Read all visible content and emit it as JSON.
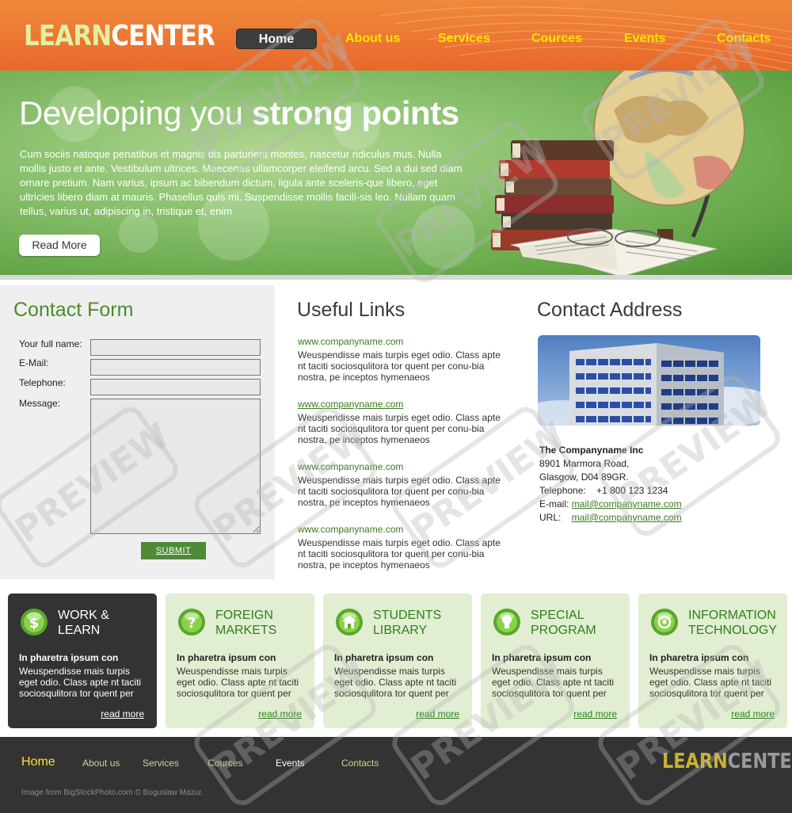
{
  "logo": {
    "part1": "LEARN",
    "part2": "CENTER"
  },
  "nav": {
    "items": [
      {
        "label": "Home",
        "active": true
      },
      {
        "label": "About us"
      },
      {
        "label": "Services"
      },
      {
        "label": "Cources"
      },
      {
        "label": "Events"
      },
      {
        "label": "Contacts"
      }
    ]
  },
  "hero": {
    "title_light": "Developing you ",
    "title_bold": "strong points",
    "text": "Cum sociis natoque penatibus et magnis dis parturient montes, nascetur ridiculus mus. Nulla mollis justo et ante. Vestibulum ultrices. Maecenas ullamcorper eleifend arcu. Sed a dui sed diam ornare pretium. Nam varius, ipsum ac bibendum dictum, ligula ante sceleris-que libero, eget ultricies libero diam at mauris. Phasellus quis mi. Suspendisse mollis facili-sis leo. Nullam quam tellus, varius ut, adipiscing in, tristique et, enim",
    "button": "Read More"
  },
  "contact_form": {
    "title": "Contact Form",
    "labels": {
      "name": "Your full name:",
      "email": "E-Mail:",
      "telephone": "Telephone:",
      "message": "Message:"
    },
    "values": {
      "name": "",
      "email": "",
      "telephone": "",
      "message": ""
    },
    "submit": "SUBMIT"
  },
  "useful_links": {
    "title": "Useful Links",
    "items": [
      {
        "url": "www.companyname.com",
        "desc": "Weuspendisse mais turpis eget odio. Class apte nt taciti sociosqulitora tor quent per conu-bia nostra, pe inceptos hymenaeos"
      },
      {
        "url": "www.companyname.com",
        "desc": "Weuspendisse mais turpis eget odio. Class apte nt taciti sociosqulitora tor quent per conu-bia nostra, pe inceptos hymenaeos"
      },
      {
        "url": "www.companyname.com",
        "desc": "Weuspendisse mais turpis eget odio. Class apte nt taciti sociosqulitora tor quent per conu-bia nostra, pe inceptos hymenaeos"
      },
      {
        "url": "www.companyname.com",
        "desc": "Weuspendisse mais turpis eget odio. Class apte nt taciti sociosqulitora tor quent per conu-bia nostra, pe inceptos hymenaeos"
      }
    ]
  },
  "contact_address": {
    "title": "Contact Address",
    "company": "The Companyname Inc",
    "street": "8901 Marmora Road,",
    "city": "Glasgow, D04 89GR.",
    "telephone_label": "Telephone:",
    "telephone": "+1 800 123 1234",
    "email_label": "E-mail:",
    "email": "mail@companyname.com",
    "url_label": "URL:",
    "url": "mail@companyname.com"
  },
  "features": [
    {
      "title_line1": "WORK &",
      "title_line2": "LEARN",
      "icon": "dollar-icon",
      "subtitle": "In pharetra ipsum con",
      "text": "Weuspendisse mais turpis eget odio. Class apte nt taciti sociosqulitora tor quent per",
      "link": "read more",
      "dark": true
    },
    {
      "title_line1": "FOREIGN",
      "title_line2": "MARKETS",
      "icon": "question-icon",
      "subtitle": "In pharetra ipsum con",
      "text": "Weuspendisse mais turpis eget odio. Class apte nt taciti sociosqulitora tor quent per",
      "link": "read more"
    },
    {
      "title_line1": "STUDENTS",
      "title_line2": "LIBRARY",
      "icon": "home-icon",
      "subtitle": "In pharetra ipsum con",
      "text": "Weuspendisse mais turpis eget odio. Class apte nt taciti sociosqulitora tor quent per",
      "link": "read more"
    },
    {
      "title_line1": "SPECIAL",
      "title_line2": "PROGRAM",
      "icon": "lightbulb-icon",
      "subtitle": "In pharetra ipsum con",
      "text": "Weuspendisse mais turpis eget odio. Class apte nt taciti sociosqulitora tor quent per",
      "link": "read more"
    },
    {
      "title_line1": "INFORMATION",
      "title_line2": "TECHNOLOGY",
      "icon": "target-icon",
      "subtitle": "In pharetra ipsum con",
      "text": "Weuspendisse mais turpis eget odio. Class apte nt taciti sociosqulitora tor quent per",
      "link": "read more"
    }
  ],
  "footer": {
    "nav": [
      "Home",
      "About us",
      "Services",
      "Cources",
      "Events",
      "Contacts"
    ],
    "logo_part1": "LEARN",
    "logo_part2": "CENTER",
    "credit": "Image from BigStockPhoto.com © Boguslaw Mazur."
  },
  "watermark": "PREVIEW",
  "colors": {
    "header": "#e8682a",
    "nav_link": "#ffe400",
    "accent_green": "#4e8a37",
    "dark_box": "#333333",
    "footer": "#333333"
  }
}
